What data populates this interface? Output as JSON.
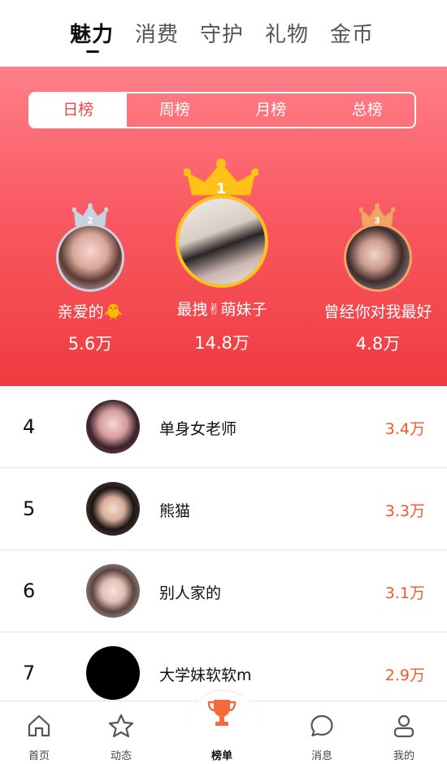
{
  "top_tabs": [
    "魅力",
    "消费",
    "守护",
    "礼物",
    "金币"
  ],
  "period_tabs": [
    "日榜",
    "周榜",
    "月榜",
    "总榜"
  ],
  "podium": [
    {
      "rank": "1",
      "name": "最拽✌萌妹子",
      "score": "14.8万"
    },
    {
      "rank": "2",
      "name": "亲爱的🐥",
      "score": "5.6万"
    },
    {
      "rank": "3",
      "name": "曾经你对我最好",
      "score": "4.8万"
    }
  ],
  "list": [
    {
      "rank": "4",
      "name": "单身女老师",
      "score": "3.4万"
    },
    {
      "rank": "5",
      "name": "熊猫",
      "score": "3.3万"
    },
    {
      "rank": "6",
      "name": "别人家的",
      "score": "3.1万"
    },
    {
      "rank": "7",
      "name": "大学妹软软m",
      "score": "2.9万"
    }
  ],
  "bottom_nav": [
    "首页",
    "动态",
    "榜单",
    "消息",
    "我的"
  ],
  "colors": {
    "accent": "#f0454b",
    "score": "#f15a2b",
    "gold": "#ffc21b",
    "silver": "#c9d3e0",
    "bronze": "#f3a462"
  }
}
